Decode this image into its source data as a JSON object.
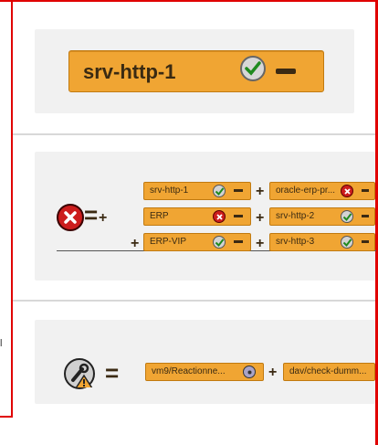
{
  "stray_text": "l",
  "panel1": {
    "label": "srv-http-1",
    "status_icon": "check-icon",
    "remove_icon": "minus-icon"
  },
  "panel2": {
    "group_status_icon": "error-icon",
    "equals": "=",
    "plus": "+",
    "items": [
      {
        "label": "srv-http-1",
        "status": "ok"
      },
      {
        "label": "oracle-erp-pr...",
        "status": "error"
      },
      {
        "label": "ERP",
        "status": "error"
      },
      {
        "label": "srv-http-2",
        "status": "ok"
      },
      {
        "label": "ERP-VIP",
        "status": "ok"
      },
      {
        "label": "srv-http-3",
        "status": "ok"
      }
    ]
  },
  "panel3": {
    "group_status_icon": "maintenance-warning-icon",
    "equals": "=",
    "plus": "+",
    "items": [
      {
        "label": "vm9/Reactionne...",
        "status": "unknown"
      },
      {
        "label": "dav/check-dumm..."
      }
    ]
  },
  "colors": {
    "pill": "#f0a533",
    "pill_border": "#c17a10",
    "frame": "#e00000",
    "error": "#cc1d1d",
    "panel_bg": "#f1f1f1"
  }
}
